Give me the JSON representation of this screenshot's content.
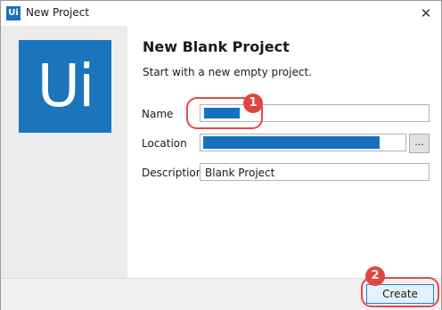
{
  "window": {
    "title": "New Project",
    "app_icon_text": "Ui",
    "close_glyph": "✕"
  },
  "logo": {
    "text": "Ui",
    "color": "#1a75bc"
  },
  "content": {
    "heading": "New Blank Project",
    "subheading": "Start with a new empty project."
  },
  "form": {
    "name_label": "Name",
    "name_value": "",
    "location_label": "Location",
    "location_value": "",
    "browse_label": "...",
    "description_label": "Description",
    "description_value": "Blank Project"
  },
  "footer": {
    "create_label": "Create"
  },
  "annotations": {
    "marker_1": "1",
    "marker_2": "2",
    "marker_color": "#e0463f"
  }
}
